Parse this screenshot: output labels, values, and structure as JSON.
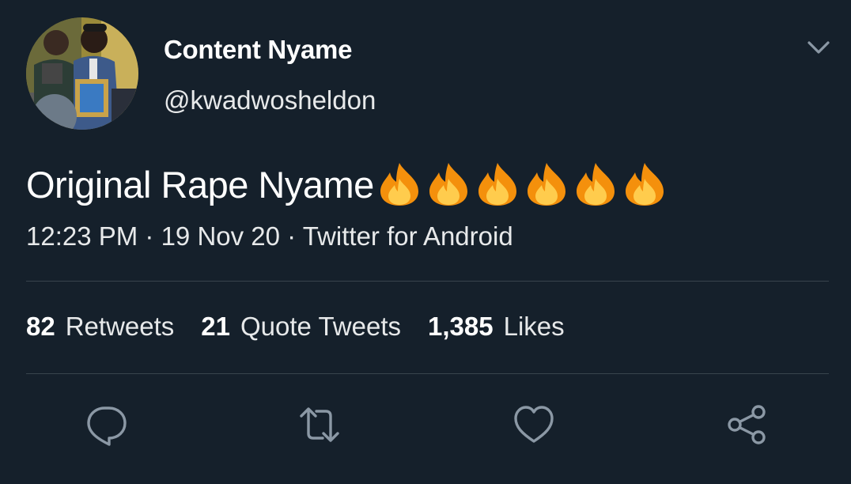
{
  "tweet": {
    "author": {
      "display_name": "Content Nyame",
      "handle": "@kwadwosheldon",
      "avatar_icon": "profile-photo"
    },
    "text": "Original Rape Nyame",
    "emoji": [
      "🔥",
      "🔥",
      "🔥",
      "🔥",
      "🔥",
      "🔥"
    ],
    "meta": "12:23 PM · 19 Nov 20 · Twitter for Android",
    "stats": [
      {
        "count": "82",
        "label": "Retweets"
      },
      {
        "count": "21",
        "label": "Quote Tweets"
      },
      {
        "count": "1,385",
        "label": "Likes"
      }
    ],
    "actions": [
      "reply-icon",
      "retweet-icon",
      "like-icon",
      "share-icon"
    ]
  },
  "colors": {
    "background": "#15202b",
    "text": "#ffffff",
    "secondary_text": "#8b98a5",
    "divider": "#38444d",
    "icon": "#8b98a5"
  }
}
